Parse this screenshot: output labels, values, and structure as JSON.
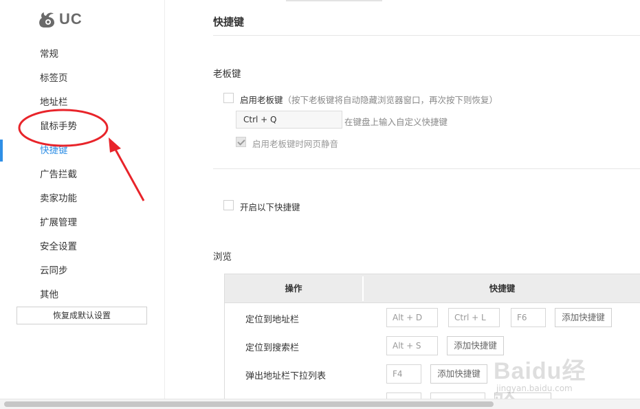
{
  "sidebar": {
    "logo_text": "UC",
    "items": [
      {
        "label": "常规"
      },
      {
        "label": "标签页"
      },
      {
        "label": "地址栏"
      },
      {
        "label": "鼠标手势"
      },
      {
        "label": "快捷键",
        "active": true
      },
      {
        "label": "广告拦截"
      },
      {
        "label": "卖家功能"
      },
      {
        "label": "扩展管理"
      },
      {
        "label": "安全设置"
      },
      {
        "label": "云同步"
      },
      {
        "label": "其他"
      }
    ],
    "restore_button": "恢复成默认设置"
  },
  "main": {
    "title": "快捷键",
    "boss_key": {
      "section_title": "老板键",
      "enable_label": "启用老板键",
      "enable_hint": "（按下老板键将自动隐藏浏览器窗口，再次按下则恢复）",
      "enable_checked": false,
      "key_value": "Ctrl + Q",
      "key_hint": "在键盘上输入自定义快捷键",
      "mute_label": "启用老板键时网页静音",
      "mute_checked": true
    },
    "enable_shortcuts": {
      "label": "开启以下快捷键",
      "checked": false
    },
    "browse": {
      "section_title": "浏览",
      "header_action": "操作",
      "header_shortcut": "快捷键",
      "add_button": "添加快捷键",
      "rows": [
        {
          "action": "定位到地址栏",
          "keys": [
            "Alt + D",
            "Ctrl + L",
            "F6"
          ]
        },
        {
          "action": "定位到搜索栏",
          "keys": [
            "Alt + S"
          ]
        },
        {
          "action": "弹出地址栏下拉列表",
          "keys": [
            "F4"
          ]
        }
      ]
    }
  },
  "watermark": {
    "brand": "Baidu经验",
    "url": "jingyan.baidu.com"
  },
  "colors": {
    "accent": "#2f8fe6",
    "annotation_red": "#e8242a"
  }
}
